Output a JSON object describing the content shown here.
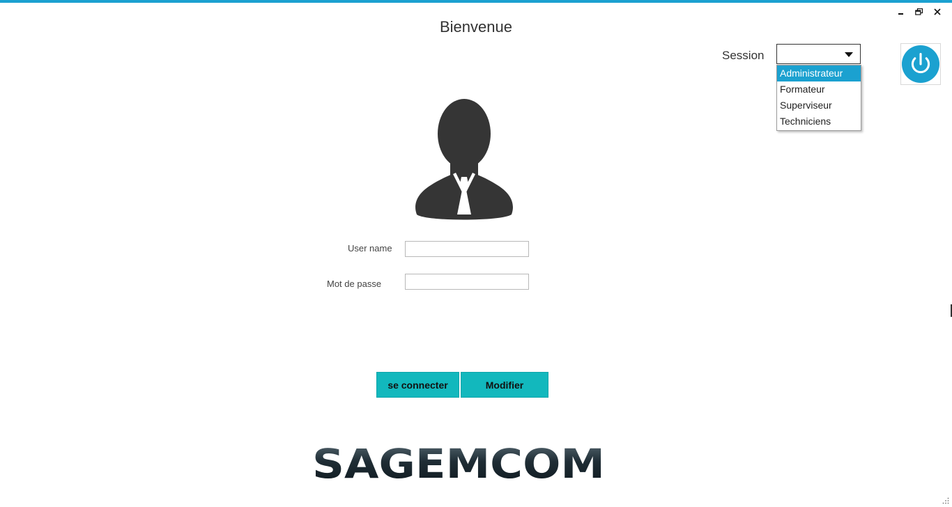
{
  "header": {
    "title": "Bienvenue"
  },
  "session": {
    "label": "Session",
    "selected_value": "",
    "options": [
      {
        "label": "Administrateur",
        "highlighted": true
      },
      {
        "label": "Formateur",
        "highlighted": false
      },
      {
        "label": "Superviseur",
        "highlighted": false
      },
      {
        "label": "Techniciens",
        "highlighted": false
      }
    ]
  },
  "form": {
    "username_label": "User name",
    "username_value": "",
    "password_label": "Mot de passe",
    "password_value": ""
  },
  "buttons": {
    "connect_label": "se connecter",
    "modify_label": "Modifier"
  },
  "branding": {
    "logo_text": "SAGEMCOM"
  },
  "icons": {
    "power": "power-icon",
    "user_avatar": "user-avatar-icon",
    "minimize": "minimize-icon",
    "restore": "restore-icon",
    "close": "close-icon"
  },
  "colors": {
    "accent": "#1ba1d0",
    "button": "#12b8bd",
    "logo_dark": "#1f2d35"
  }
}
